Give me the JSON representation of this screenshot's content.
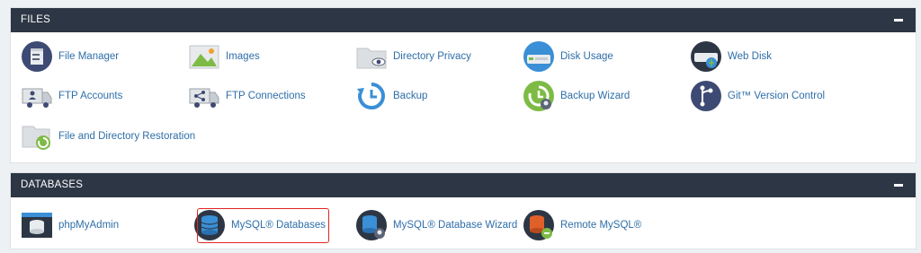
{
  "files": {
    "header": "FILES",
    "items": [
      {
        "label": "File Manager",
        "icon": "file-manager-icon"
      },
      {
        "label": "Images",
        "icon": "images-icon"
      },
      {
        "label": "Directory Privacy",
        "icon": "directory-privacy-icon"
      },
      {
        "label": "Disk Usage",
        "icon": "disk-usage-icon"
      },
      {
        "label": "Web Disk",
        "icon": "web-disk-icon"
      },
      {
        "label": "FTP Accounts",
        "icon": "ftp-accounts-icon"
      },
      {
        "label": "FTP Connections",
        "icon": "ftp-connections-icon"
      },
      {
        "label": "Backup",
        "icon": "backup-icon"
      },
      {
        "label": "Backup Wizard",
        "icon": "backup-wizard-icon"
      },
      {
        "label": "Git™ Version Control",
        "icon": "git-icon"
      },
      {
        "label": "File and Directory Restoration",
        "icon": "file-restoration-icon"
      }
    ]
  },
  "databases": {
    "header": "DATABASES",
    "items": [
      {
        "label": "phpMyAdmin",
        "icon": "phpmyadmin-icon"
      },
      {
        "label": "MySQL® Databases",
        "icon": "mysql-databases-icon"
      },
      {
        "label": "MySQL® Database Wizard",
        "icon": "mysql-wizard-icon"
      },
      {
        "label": "Remote MySQL®",
        "icon": "remote-mysql-icon"
      }
    ]
  },
  "colors": {
    "header_bg": "#2d3644",
    "link": "#2e6ea8",
    "highlight": "#e02424",
    "accent_blue": "#3a8fd6",
    "accent_green": "#7dbb45"
  }
}
